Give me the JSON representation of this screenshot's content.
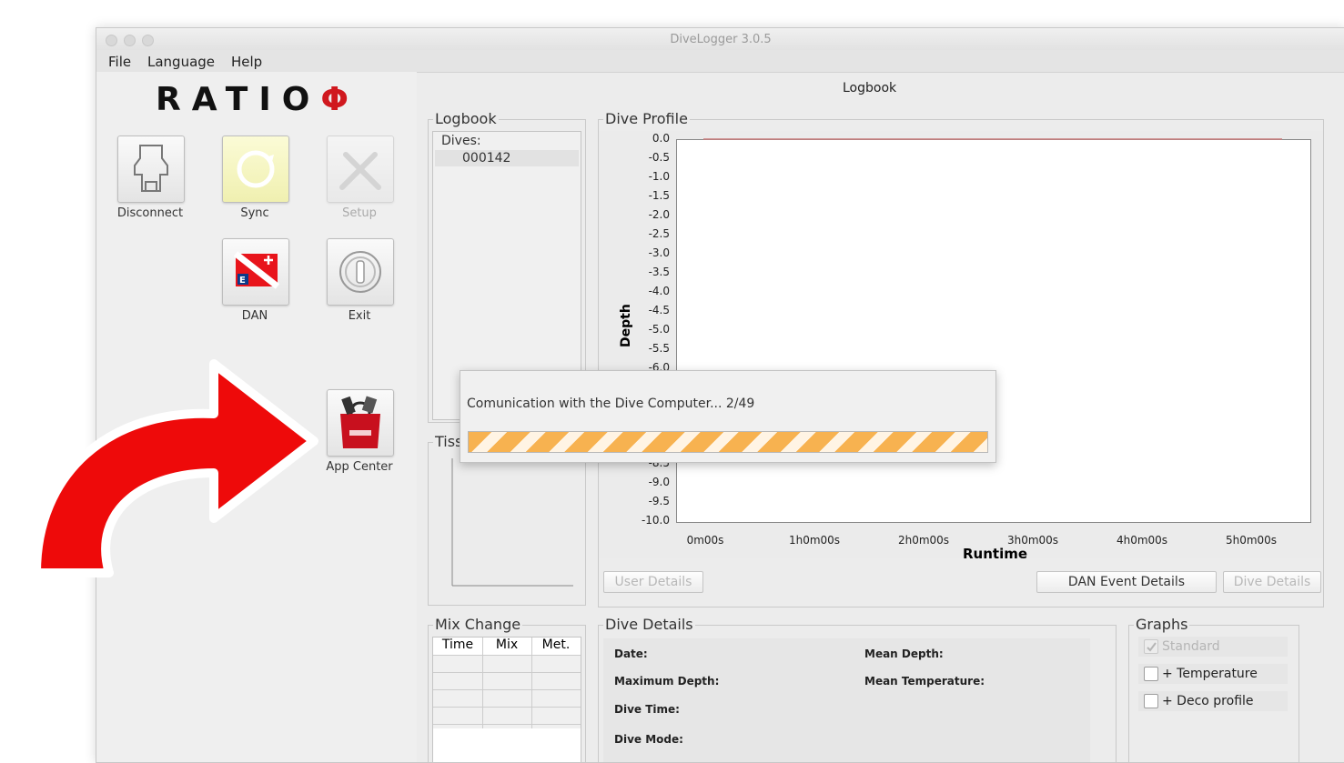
{
  "window": {
    "title": "DiveLogger 3.0.5"
  },
  "menu": [
    "File",
    "Language",
    "Help"
  ],
  "logo": {
    "text": "RATIO",
    "symbol": "Φ"
  },
  "tools": {
    "disconnect": "Disconnect",
    "sync": "Sync",
    "setup": "Setup",
    "dan": "DAN",
    "exit": "Exit",
    "app_center": "App Center"
  },
  "main": {
    "header": "Logbook"
  },
  "logbook": {
    "title": "Logbook",
    "list_header": "Dives:",
    "dives": [
      "000142"
    ]
  },
  "tissue": {
    "title": "Tiss"
  },
  "dive_profile": {
    "title": "Dive Profile",
    "buttons": {
      "user_details": "User Details",
      "dan_event_details": "DAN Event Details",
      "dive_details": "Dive Details"
    }
  },
  "chart_data": {
    "type": "line",
    "xlabel": "Runtime",
    "ylabel": "Depth",
    "x_ticks": [
      "0m00s",
      "1h0m00s",
      "2h0m00s",
      "3h0m00s",
      "4h0m00s",
      "5h0m00s"
    ],
    "y_ticks": [
      "0.0",
      "-0.5",
      "-1.0",
      "-1.5",
      "-2.0",
      "-2.5",
      "-3.0",
      "-3.5",
      "-4.0",
      "-4.5",
      "-5.0",
      "-5.5",
      "-6.0",
      "-8.5",
      "-9.0",
      "-9.5",
      "-10.0"
    ],
    "ylim": [
      -10.0,
      0.0
    ],
    "series": [
      {
        "x": [
          "0m00s",
          "5h0m00s"
        ],
        "values": [
          0.0,
          0.0
        ],
        "color": "#c77b7b"
      }
    ]
  },
  "mix_change": {
    "title": "Mix Change",
    "columns": [
      "Time",
      "Mix",
      "Met."
    ]
  },
  "dive_details": {
    "title": "Dive Details",
    "labels": {
      "date": "Date:",
      "max_depth": "Maximum Depth:",
      "dive_time": "Dive Time:",
      "dive_mode": "Dive Mode:",
      "mean_depth": "Mean Depth:",
      "mean_temp": "Mean Temperature:"
    }
  },
  "graphs": {
    "title": "Graphs",
    "options": [
      "Standard",
      "+ Temperature",
      "+ Deco profile"
    ]
  },
  "dialog": {
    "message": "Comunication with the Dive Computer... 2/49",
    "progress": 0.041
  },
  "colors": {
    "arrow": "#ee0a0a",
    "progress": "#f7b250",
    "logo_symbol": "#d0181e"
  }
}
